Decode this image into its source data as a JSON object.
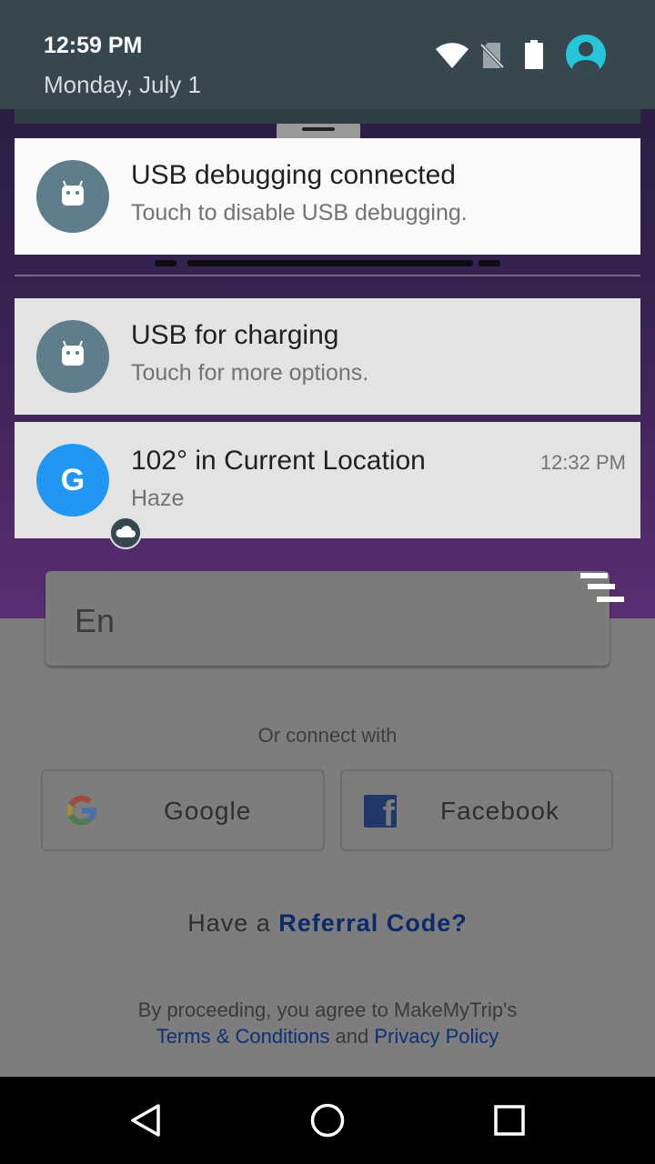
{
  "status_bar": {
    "time": "12:59 PM",
    "date": "Monday, July 1"
  },
  "notifications": [
    {
      "title": "USB debugging connected",
      "subtitle": "Touch to disable USB debugging.",
      "icon": "android-icon"
    },
    {
      "title": "USB for charging",
      "subtitle": "Touch for more options.",
      "icon": "android-icon"
    },
    {
      "title": "102° in Current Location",
      "subtitle": "Haze",
      "time": "12:32 PM",
      "icon": "google-icon",
      "badge_icon": "cloud-icon"
    }
  ],
  "app": {
    "input_value": "En",
    "or_connect": "Or connect with",
    "google_label": "Google",
    "facebook_label": "Facebook",
    "referral_prefix": "Have a ",
    "referral_link": "Referral Code?",
    "terms_line1": "By proceeding, you agree to MakeMyTrip's",
    "terms_link": "Terms & Conditions",
    "terms_and": " and ",
    "privacy_link": "Privacy Policy"
  },
  "colors": {
    "shade_header": "#37474f",
    "avatar": "#26c6da",
    "google_blue": "#2196f3",
    "link_blue": "#0e2f78"
  }
}
